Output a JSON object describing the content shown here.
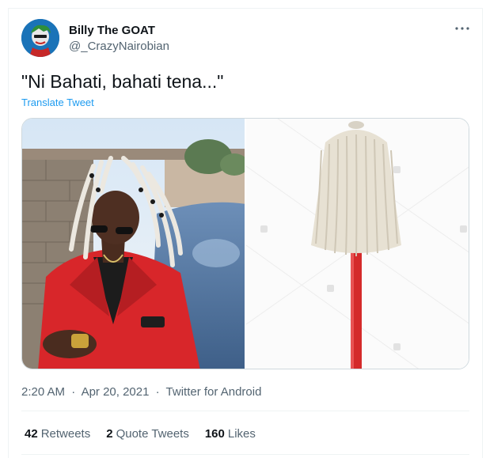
{
  "user": {
    "display_name": "Billy The GOAT",
    "handle": "@_CrazyNairobian"
  },
  "tweet": {
    "text": "\"Ni Bahati, bahati tena...\"",
    "translate_label": "Translate Tweet"
  },
  "meta": {
    "time": "2:20 AM",
    "separator": "·",
    "date": "Apr 20, 2021",
    "source": "Twitter for Android"
  },
  "stats": [
    {
      "count": "42",
      "label": "Retweets"
    },
    {
      "count": "2",
      "label": "Quote Tweets"
    },
    {
      "count": "160",
      "label": "Likes"
    }
  ],
  "icons": {
    "more": "more-horizontal-icon"
  },
  "colors": {
    "link": "#1d9bf0",
    "secondary_text": "#536471",
    "primary_text": "#0f1419",
    "border": "#cfd9de",
    "divider": "#eff3f4"
  }
}
